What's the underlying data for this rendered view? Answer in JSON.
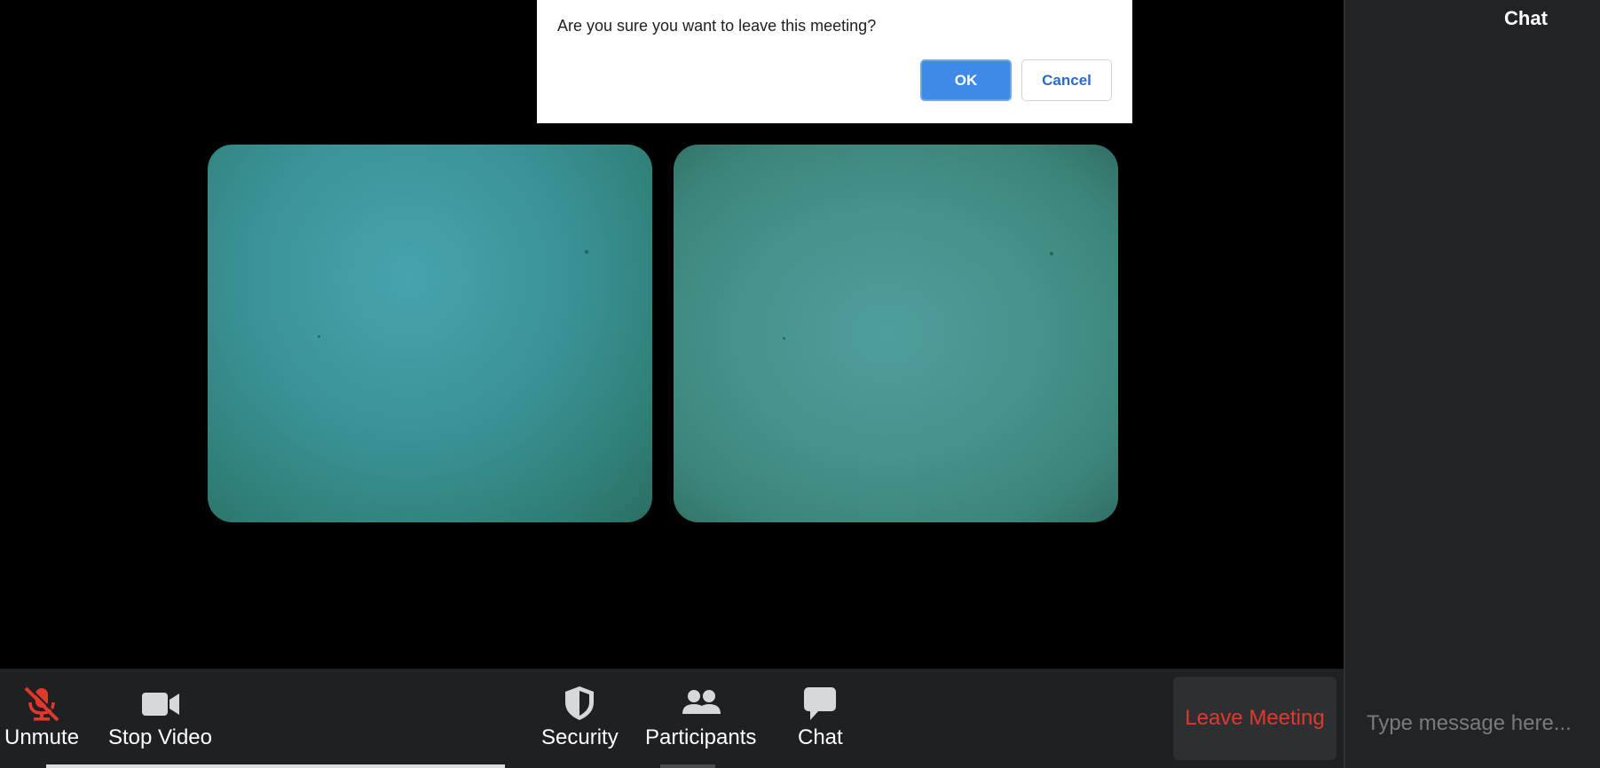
{
  "dialog": {
    "message": "Are you sure you want to leave this meeting?",
    "ok_label": "OK",
    "cancel_label": "Cancel"
  },
  "toolbar": {
    "unmute_label": "Unmute",
    "stop_video_label": "Stop Video",
    "security_label": "Security",
    "participants_label": "Participants",
    "chat_label": "Chat",
    "leave_label": "Leave Meeting",
    "icons": {
      "unmute": "microphone-muted-icon",
      "stop_video": "video-camera-icon",
      "security": "shield-icon",
      "participants": "people-icon",
      "chat": "speech-bubble-icon"
    }
  },
  "chat_panel": {
    "title": "Chat",
    "input_placeholder": "Type message here..."
  },
  "colors": {
    "accent": "#3f8ae6",
    "leave": "#e0392c",
    "muted_mic": "#e0392c",
    "toolbar_bg": "#1f2023",
    "panel_bg": "#222326"
  }
}
